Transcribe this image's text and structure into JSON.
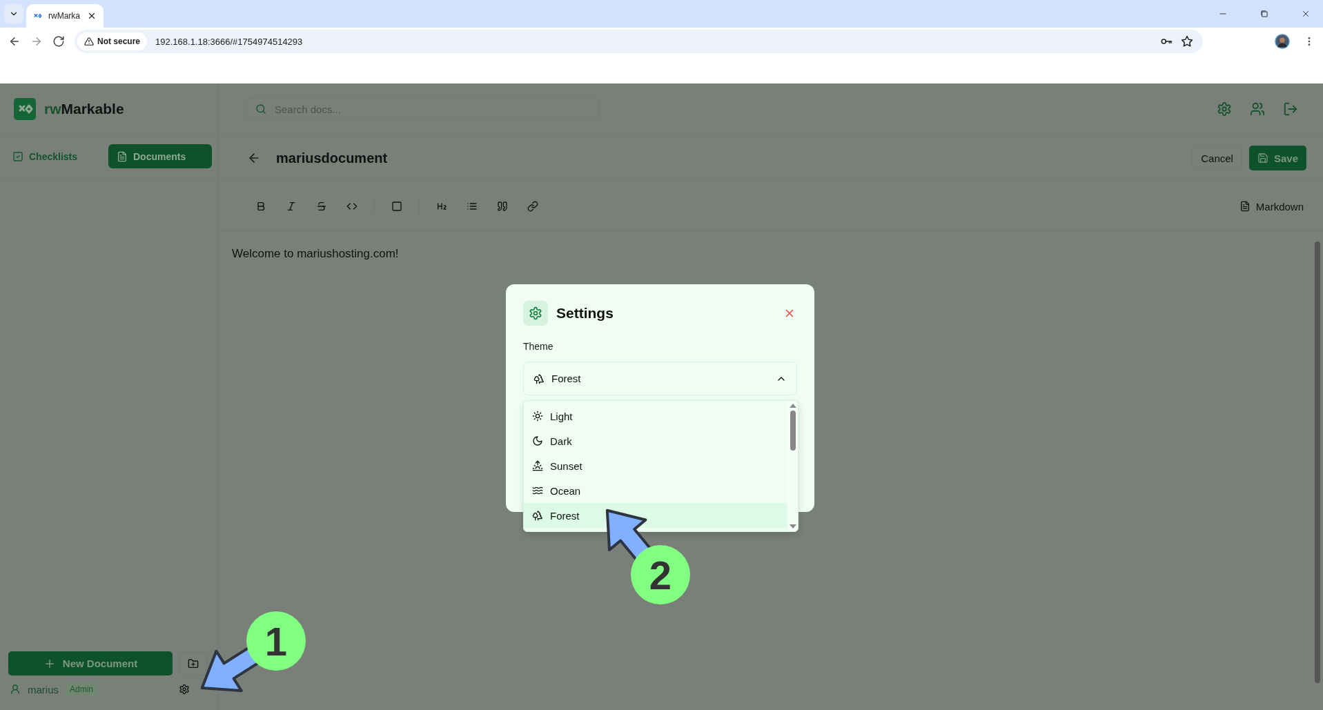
{
  "browser": {
    "tab_title": "rwMarka",
    "not_secure": "Not secure",
    "url": "192.168.1.18:3666/#1754974514293"
  },
  "app": {
    "brand": {
      "accent": "rw",
      "name": "Markable"
    },
    "search": {
      "placeholder": "Search docs..."
    },
    "sidebar": {
      "tabs": [
        {
          "label": "Checklists",
          "kind": "checklists",
          "selected": false
        },
        {
          "label": "Documents",
          "kind": "documents",
          "selected": true
        }
      ],
      "new_button": "New Document",
      "user": {
        "name": "marius",
        "role": "Admin"
      }
    },
    "document": {
      "title": "mariusdocument",
      "cancel": "Cancel",
      "save": "Save",
      "mode": "Markdown",
      "body": "Welcome to mariushosting.com!",
      "toolbar": [
        {
          "kind": "bold"
        },
        {
          "kind": "italic"
        },
        {
          "kind": "strike"
        },
        {
          "kind": "code"
        },
        {
          "kind": "separator"
        },
        {
          "kind": "checkbox"
        },
        {
          "kind": "separator"
        },
        {
          "kind": "heading"
        },
        {
          "kind": "list"
        },
        {
          "kind": "quote"
        },
        {
          "kind": "link"
        }
      ]
    }
  },
  "settings": {
    "title": "Settings",
    "theme_label": "Theme",
    "value": {
      "label": "Forest",
      "kind": "forest"
    },
    "expanded": true,
    "options": [
      {
        "label": "Light",
        "kind": "light",
        "selected": false
      },
      {
        "label": "Dark",
        "kind": "dark",
        "selected": false
      },
      {
        "label": "Sunset",
        "kind": "sunset",
        "selected": false
      },
      {
        "label": "Ocean",
        "kind": "ocean",
        "selected": false
      },
      {
        "label": "Forest",
        "kind": "forest",
        "selected": true
      }
    ]
  },
  "annotations": [
    {
      "number": "1"
    },
    {
      "number": "2"
    }
  ]
}
